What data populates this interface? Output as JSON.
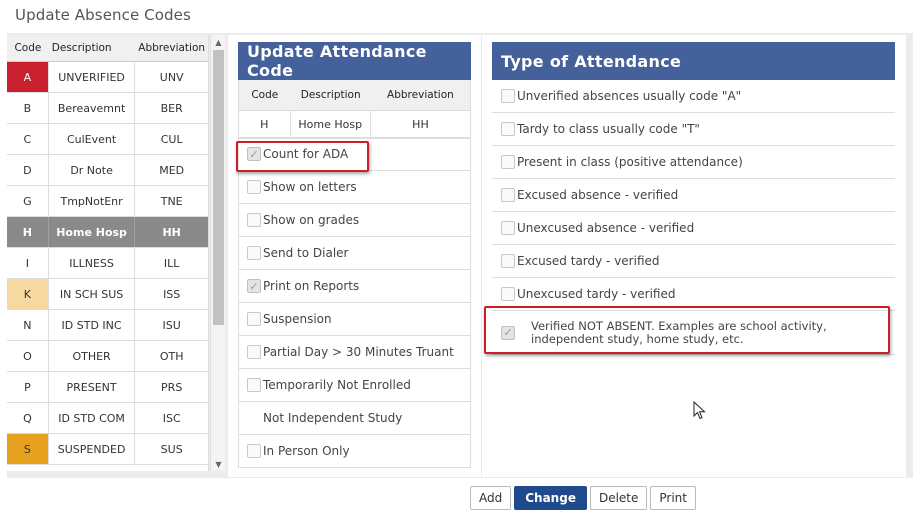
{
  "window": {
    "title": "Update Absence Codes"
  },
  "codes_list": {
    "headers": {
      "code": "Code",
      "description": "Description",
      "abbreviation": "Abbreviation"
    },
    "rows": [
      {
        "code": "A",
        "description": "UNVERIFIED",
        "abbreviation": "UNV",
        "color": "#c8202e"
      },
      {
        "code": "B",
        "description": "Bereavemnt",
        "abbreviation": "BER",
        "color": ""
      },
      {
        "code": "C",
        "description": "CulEvent",
        "abbreviation": "CUL",
        "color": ""
      },
      {
        "code": "D",
        "description": "Dr Note",
        "abbreviation": "MED",
        "color": ""
      },
      {
        "code": "G",
        "description": "TmpNotEnr",
        "abbreviation": "TNE",
        "color": ""
      },
      {
        "code": "H",
        "description": "Home Hosp",
        "abbreviation": "HH",
        "color": "",
        "selected": true
      },
      {
        "code": "I",
        "description": "ILLNESS",
        "abbreviation": "ILL",
        "color": ""
      },
      {
        "code": "K",
        "description": "IN SCH SUS",
        "abbreviation": "ISS",
        "color": "#f5d9a0"
      },
      {
        "code": "N",
        "description": "ID STD INC",
        "abbreviation": "ISU",
        "color": ""
      },
      {
        "code": "O",
        "description": "OTHER",
        "abbreviation": "OTH",
        "color": ""
      },
      {
        "code": "P",
        "description": "PRESENT",
        "abbreviation": "PRS",
        "color": ""
      },
      {
        "code": "Q",
        "description": "ID STD COM",
        "abbreviation": "ISC",
        "color": ""
      },
      {
        "code": "S",
        "description": "SUSPENDED",
        "abbreviation": "SUS",
        "color": "#e6a21f"
      }
    ]
  },
  "update_attendance": {
    "title": "Update Attendance Code",
    "headers": {
      "code": "Code",
      "description": "Description",
      "abbreviation": "Abbreviation"
    },
    "current": {
      "code": "H",
      "description": "Home Hosp",
      "abbreviation": "HH"
    },
    "options": [
      {
        "label": "Count for ADA",
        "checked": true,
        "has_checkbox": true
      },
      {
        "label": "Show on letters",
        "checked": false,
        "has_checkbox": true
      },
      {
        "label": "Show on grades",
        "checked": false,
        "has_checkbox": true
      },
      {
        "label": "Send to Dialer",
        "checked": false,
        "has_checkbox": true
      },
      {
        "label": "Print on Reports",
        "checked": true,
        "has_checkbox": true
      },
      {
        "label": "Suspension",
        "checked": false,
        "has_checkbox": true
      },
      {
        "label": "Partial Day > 30 Minutes Truant",
        "checked": false,
        "has_checkbox": true
      },
      {
        "label": "Temporarily Not Enrolled",
        "checked": false,
        "has_checkbox": true
      },
      {
        "label": "Not Independent Study",
        "checked": false,
        "has_checkbox": false
      },
      {
        "label": "In Person Only",
        "checked": false,
        "has_checkbox": true
      }
    ]
  },
  "type_of_attendance": {
    "title": "Type of Attendance",
    "options": [
      {
        "label": "Unverified absences usually code \"A\"",
        "checked": false
      },
      {
        "label": "Tardy to class usually code \"T\"",
        "checked": false
      },
      {
        "label": "Present in class (positive attendance)",
        "checked": false
      },
      {
        "label": "Excused absence - verified",
        "checked": false
      },
      {
        "label": "Unexcused absence - verified",
        "checked": false
      },
      {
        "label": "Excused tardy - verified",
        "checked": false
      },
      {
        "label": "Unexcused tardy - verified",
        "checked": false
      },
      {
        "label": "Verified NOT ABSENT. Examples are school activity, independent study, home study, etc.",
        "checked": true
      }
    ]
  },
  "buttons": {
    "add": "Add",
    "change": "Change",
    "delete": "Delete",
    "print": "Print"
  },
  "colors": {
    "panel_header": "#44619b",
    "primary_button": "#1f4b8e",
    "highlight": "#cc1f2a"
  },
  "icons": {
    "checkmark": "check-icon",
    "scroll_up": "caret-up-icon",
    "scroll_down": "caret-down-icon",
    "cursor": "mouse-pointer-icon"
  }
}
